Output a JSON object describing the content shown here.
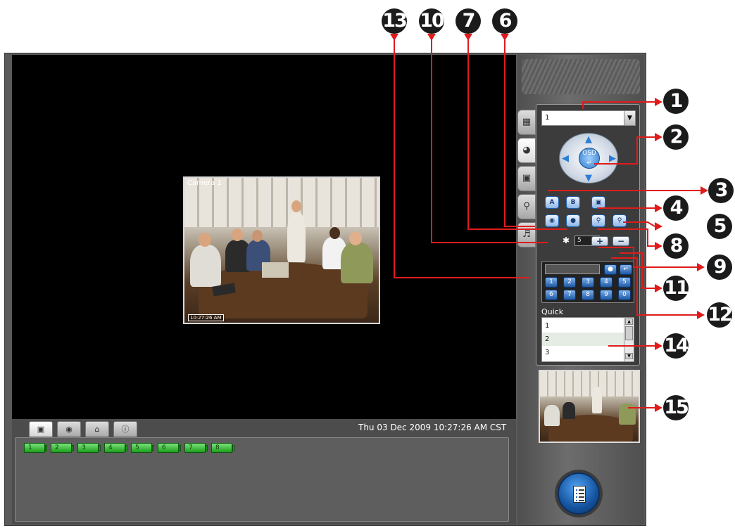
{
  "feed": {
    "label": "Camera 1",
    "timestamp": "10:27:26 AM"
  },
  "camera_select": {
    "value": "1"
  },
  "ptz": {
    "center_label": "OSD"
  },
  "dwell": {
    "value": "5"
  },
  "buttons": {
    "plus": "+",
    "minus": "−",
    "enter": "↵",
    "a": "A",
    "b": "B"
  },
  "numpad": {
    "keys": [
      "1",
      "2",
      "3",
      "4",
      "5",
      "6",
      "7",
      "8",
      "9",
      "0"
    ]
  },
  "quick": {
    "label": "Quick",
    "items": [
      "1",
      "2",
      "3"
    ]
  },
  "bottom": {
    "datetime": "Thu 03 Dec 2009 10:27:26 AM CST",
    "cameras": [
      "1",
      "2",
      "3",
      "4",
      "5",
      "6",
      "7",
      "8"
    ]
  },
  "callouts": [
    "13",
    "10",
    "7",
    "6",
    "1",
    "2",
    "3",
    "4",
    "5",
    "8",
    "9",
    "11",
    "12",
    "14",
    "15"
  ]
}
